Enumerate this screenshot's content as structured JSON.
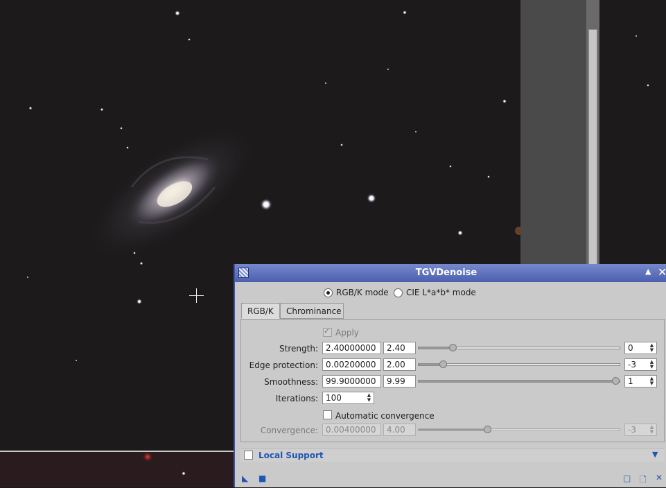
{
  "window": {
    "title": "TGVDenoise",
    "shade_icon": "shade-up-icon",
    "close_icon": "close-icon"
  },
  "mode": {
    "rgbk_label": "RGB/K mode",
    "cielab_label": "CIE L*a*b* mode",
    "selected": "RGB/K mode"
  },
  "tabs": [
    {
      "label": "RGB/K",
      "active": true
    },
    {
      "label": "Chrominance",
      "active": false
    }
  ],
  "apply": {
    "label": "Apply",
    "checked": true
  },
  "params": [
    {
      "label": "Strength:",
      "value": "2.40000000",
      "short": "2.40",
      "slider": 0.17,
      "spin": "0"
    },
    {
      "label": "Edge protection:",
      "value": "0.00200000",
      "short": "2.00",
      "slider": 0.12,
      "spin": "-3"
    },
    {
      "label": "Smoothness:",
      "value": "99.9000000",
      "short": "9.99",
      "slider": 0.98,
      "spin": "1"
    }
  ],
  "iterations": {
    "label": "Iterations:",
    "value": "100"
  },
  "auto_convergence": {
    "label": "Automatic convergence",
    "checked": false
  },
  "convergence": {
    "label": "Convergence:",
    "value": "0.00400000",
    "short": "4.00",
    "slider": 0.34,
    "spin": "-3"
  },
  "local_support": {
    "label": "Local Support",
    "checked": false
  },
  "colors": {
    "accent": "#1f55b3",
    "titlebar": "#4b5fae"
  },
  "bottom_icons": [
    "apply-global-icon",
    "execute-icon",
    "preview-icon",
    "new-instance-icon",
    "reset-icon"
  ]
}
